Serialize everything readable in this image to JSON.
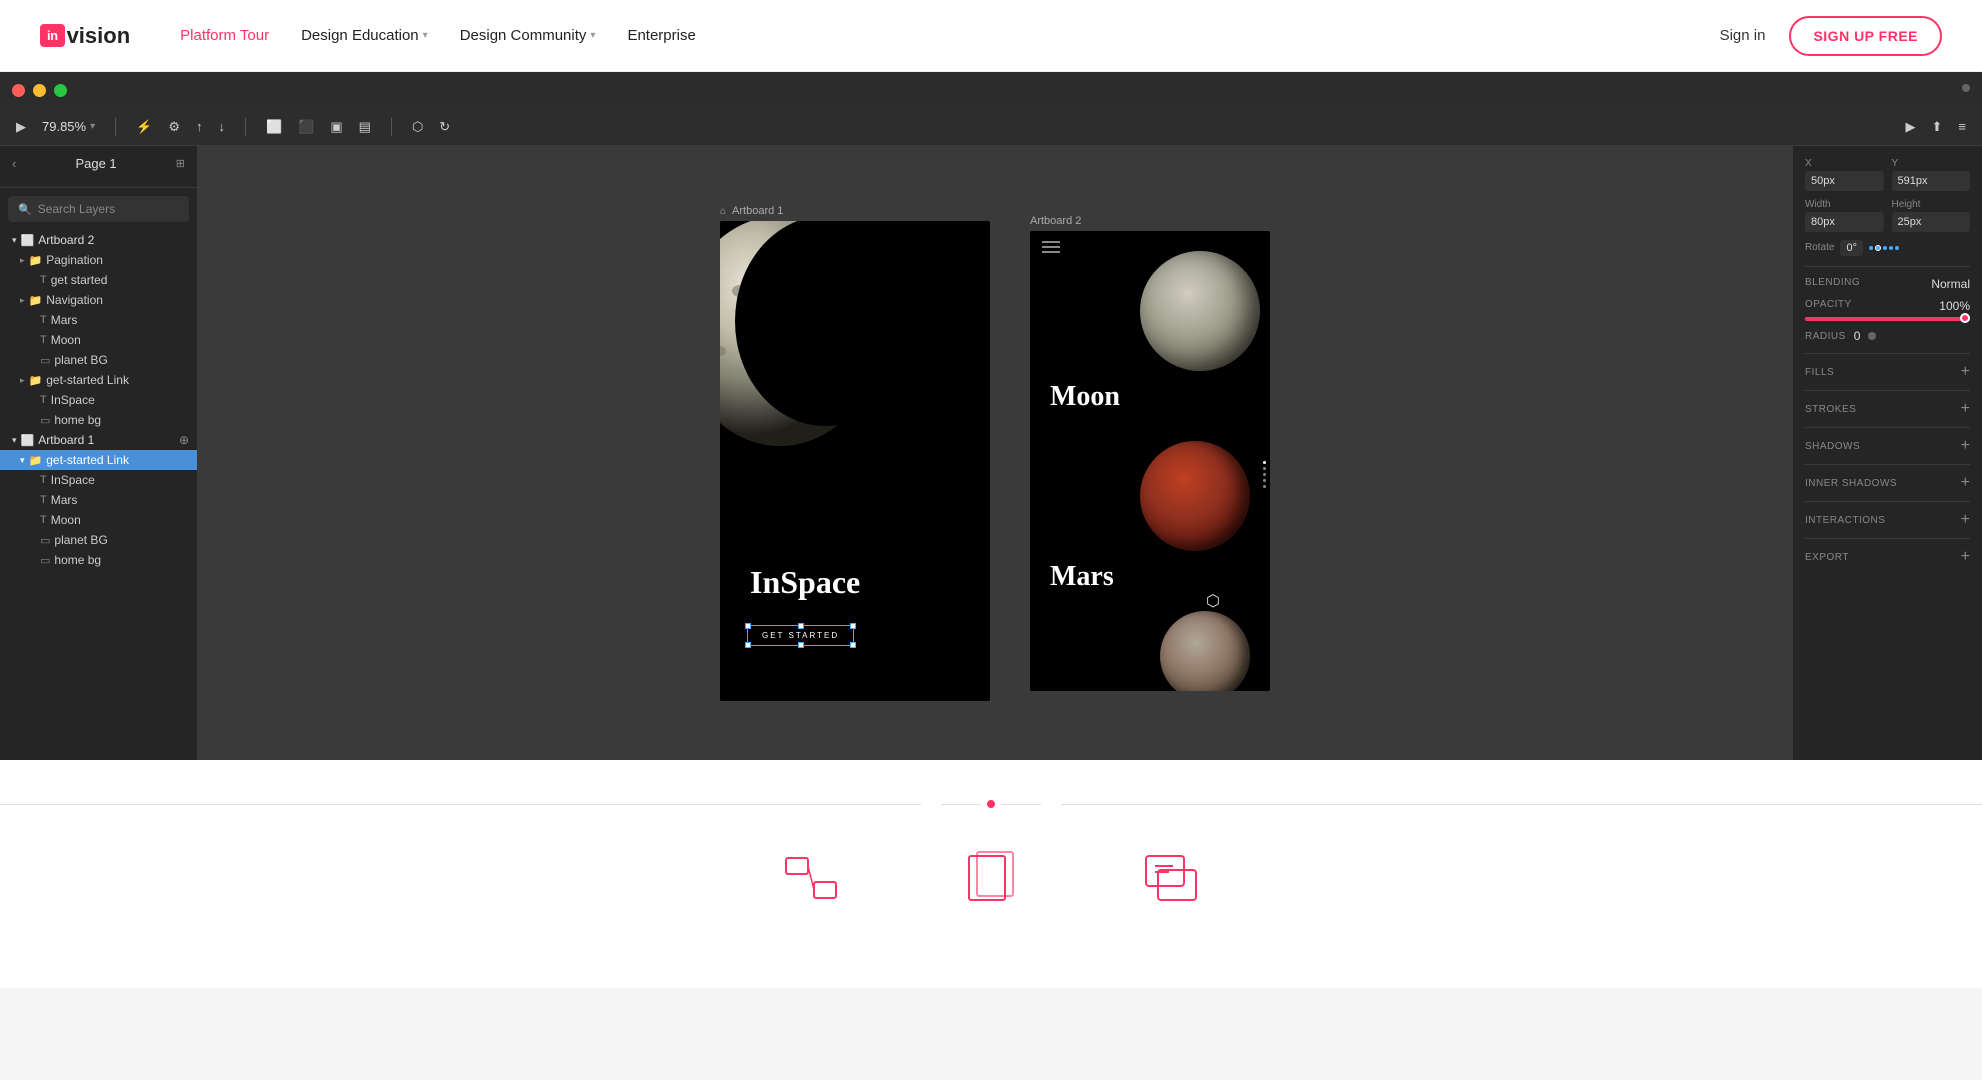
{
  "nav": {
    "logo_box": "in",
    "logo_text": "vision",
    "links": [
      {
        "label": "Platform Tour",
        "has_chevron": false,
        "active": true
      },
      {
        "label": "Design Education",
        "has_chevron": true,
        "active": false
      },
      {
        "label": "Design Community",
        "has_chevron": true,
        "active": false
      },
      {
        "label": "Enterprise",
        "has_chevron": false,
        "active": false
      }
    ],
    "sign_in": "Sign in",
    "sign_up": "SIGN UP FREE"
  },
  "window": {
    "page_title": "Page 1",
    "zoom": "79.85%",
    "search_placeholder": "Search Layers"
  },
  "sidebar": {
    "layers": [
      {
        "type": "group",
        "label": "Artboard 2",
        "indent": 0,
        "open": true,
        "selected": false
      },
      {
        "type": "group",
        "label": "Pagination",
        "indent": 1,
        "open": false,
        "selected": false
      },
      {
        "type": "text",
        "label": "get started",
        "indent": 2,
        "selected": false
      },
      {
        "type": "group",
        "label": "Navigation",
        "indent": 1,
        "open": false,
        "selected": false
      },
      {
        "type": "text",
        "label": "Mars",
        "indent": 2,
        "selected": false
      },
      {
        "type": "text",
        "label": "Moon",
        "indent": 2,
        "selected": false
      },
      {
        "type": "rect",
        "label": "planet BG",
        "indent": 2,
        "selected": false
      },
      {
        "type": "group",
        "label": "get-started Link",
        "indent": 1,
        "open": false,
        "selected": false
      },
      {
        "type": "text",
        "label": "InSpace",
        "indent": 2,
        "selected": false
      },
      {
        "type": "rect",
        "label": "home bg",
        "indent": 2,
        "selected": false
      },
      {
        "type": "group",
        "label": "Artboard 1",
        "indent": 0,
        "open": true,
        "selected": false
      },
      {
        "type": "group",
        "label": "get-started Link",
        "indent": 1,
        "open": true,
        "selected": true
      },
      {
        "type": "text",
        "label": "InSpace",
        "indent": 2,
        "selected": false
      },
      {
        "type": "text",
        "label": "Mars",
        "indent": 2,
        "selected": false
      },
      {
        "type": "text",
        "label": "Moon",
        "indent": 2,
        "selected": false
      },
      {
        "type": "rect",
        "label": "planet BG",
        "indent": 2,
        "selected": false
      },
      {
        "type": "rect",
        "label": "home bg",
        "indent": 2,
        "selected": false
      }
    ]
  },
  "canvas": {
    "artboard1_label": "Artboard 1",
    "artboard2_label": "Artboard 2",
    "ab1_title": "InSpace",
    "ab1_btn": "GET STARTED",
    "ab2_moon_label": "Moon",
    "ab2_mars_label": "Mars"
  },
  "right_panel": {
    "x_label": "X",
    "x_value": "50px",
    "y_label": "Y",
    "y_value": "591px",
    "width_label": "Width",
    "width_value": "80px",
    "height_label": "Height",
    "height_value": "25px",
    "rotate_label": "Rotate",
    "rotate_value": "0°",
    "blending_label": "Blending",
    "blending_value": "Normal",
    "opacity_label": "Opacity",
    "opacity_value": "100%",
    "radius_label": "Radius",
    "radius_value": "0",
    "fills_label": "FILLS",
    "strokes_label": "STROKES",
    "shadows_label": "SHADOWS",
    "inner_shadows_label": "INNER SHADOWS",
    "interactions_label": "INTERACTIONS",
    "export_label": "EXPORT"
  },
  "bottom": {
    "icons": [
      {
        "name": "prototype-icon",
        "type": "prototype"
      },
      {
        "name": "screens-icon",
        "type": "screens"
      },
      {
        "name": "comment-icon",
        "type": "comment"
      }
    ]
  }
}
